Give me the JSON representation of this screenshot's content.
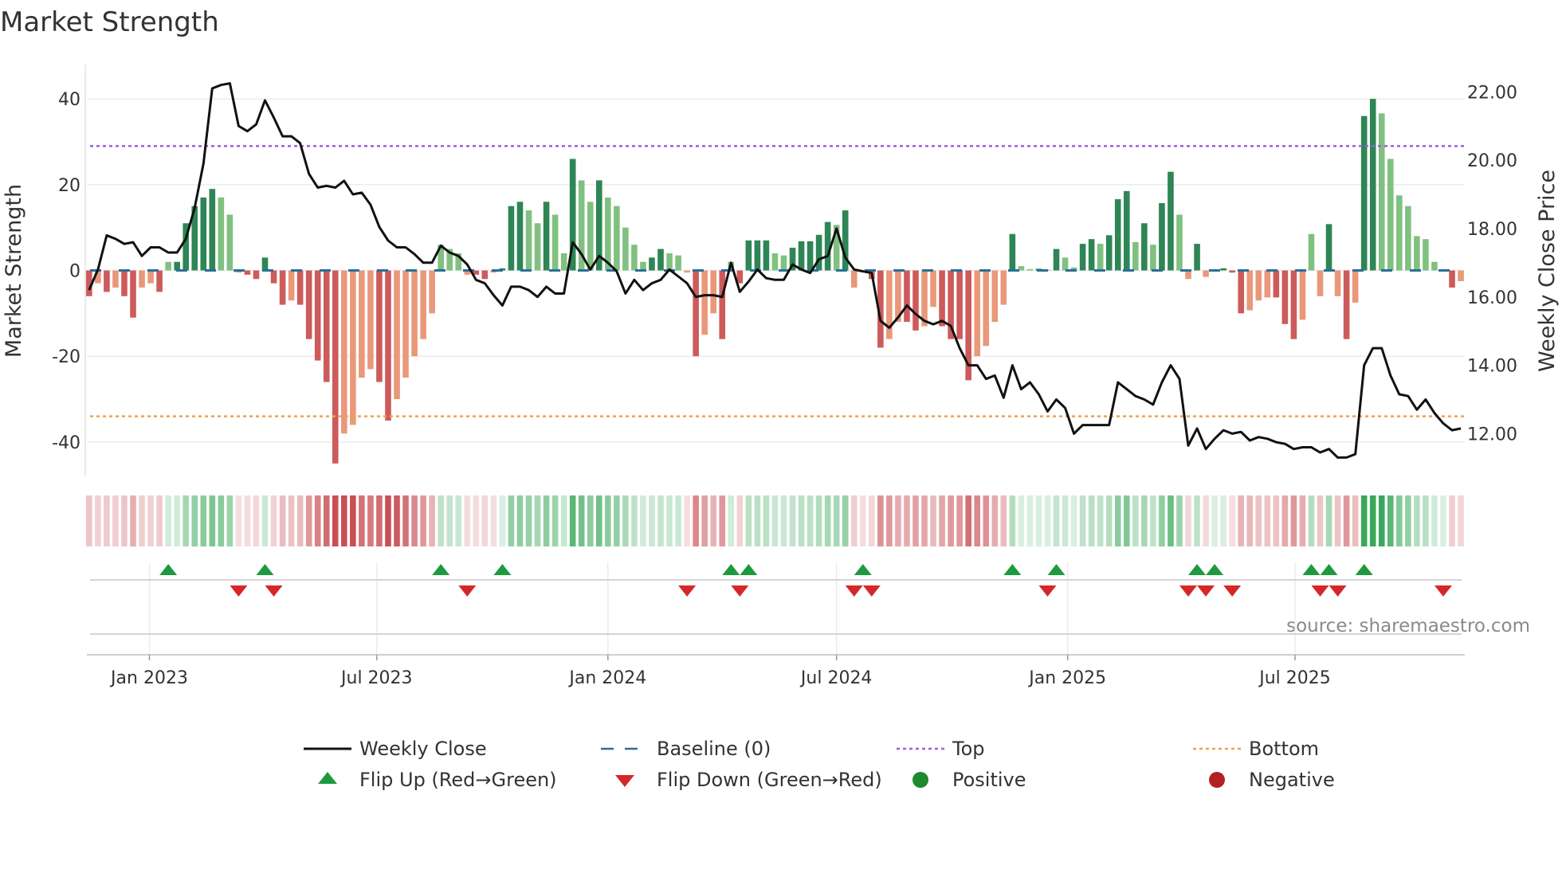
{
  "chart_data": {
    "type": "bar",
    "title": "Market Strength",
    "ylabel": "Market Strength",
    "ylabel_right": "Weekly Close Price",
    "ylim": [
      -48,
      48
    ],
    "ylim_right": [
      10.75,
      22.8
    ],
    "yticks": [
      -40,
      -20,
      0,
      20,
      40
    ],
    "yticks_right": [
      "12.00",
      "14.00",
      "16.00",
      "18.00",
      "20.00",
      "22.00"
    ],
    "xticks": [
      {
        "date": "2023-01-01",
        "label": "Jan 2023"
      },
      {
        "date": "2023-07-01",
        "label": "Jul 2023"
      },
      {
        "date": "2024-01-01",
        "label": "Jan 2024"
      },
      {
        "date": "2024-07-01",
        "label": "Jul 2024"
      },
      {
        "date": "2025-01-01",
        "label": "Jan 2025"
      },
      {
        "date": "2025-07-01",
        "label": "Jul 2025"
      }
    ],
    "start_date": "2022-11-14",
    "interval_days": 7,
    "top_level": 29,
    "bottom_level": -34,
    "baseline": 0,
    "strength": [
      -6,
      -3,
      -5,
      -4,
      -6,
      -11,
      -4,
      -3,
      -5,
      2,
      2,
      11,
      15,
      17,
      19,
      17,
      13,
      -0.5,
      -1,
      -2,
      3,
      -3,
      -8,
      -7,
      -8,
      -16,
      -21,
      -26,
      -45,
      -38,
      -36,
      -25,
      -23,
      -26,
      -35,
      -30,
      -25,
      -20,
      -16,
      -10,
      6,
      5,
      4,
      -1,
      -1,
      -2,
      -0.5,
      0.5,
      15,
      16,
      14,
      11,
      16,
      13,
      4,
      26,
      21,
      16,
      21,
      17,
      15,
      10,
      6,
      2,
      3,
      5,
      4,
      3.5,
      -0.5,
      -20,
      -15,
      -10,
      -16,
      2,
      -3,
      7,
      7,
      7,
      4,
      3.5,
      5.3,
      6.8,
      6.8,
      8.3,
      11.3,
      10.6,
      14,
      -4,
      -0.3,
      -2,
      -18,
      -16,
      -12,
      -12,
      -14,
      -13,
      -8.5,
      -13,
      -16,
      -16,
      -25.6,
      -20,
      -17.6,
      -12,
      -8,
      8.5,
      1,
      0.3,
      0.4,
      0.2,
      5,
      3,
      0.7,
      6.2,
      7.3,
      6.2,
      8.2,
      16.6,
      18.5,
      6.6,
      11,
      6,
      15.7,
      23,
      13,
      -2,
      6.2,
      -1.5,
      0,
      0.5,
      -0.5,
      -10,
      -9.3,
      -7,
      -6.3,
      -6.3,
      -12.5,
      -16,
      -11.5,
      8.5,
      -6,
      10.8,
      -6,
      -16,
      -7.5,
      36,
      40,
      36.6,
      26,
      17.5,
      15,
      8,
      7.3,
      2,
      0.2,
      -4,
      -2.5
    ],
    "close": [
      16.2,
      16.8,
      17.8,
      17.7,
      17.55,
      17.6,
      17.2,
      17.45,
      17.45,
      17.3,
      17.3,
      17.7,
      18.6,
      19.9,
      22.1,
      22.2,
      22.25,
      21.0,
      20.85,
      21.05,
      21.75,
      21.25,
      20.7,
      20.7,
      20.5,
      19.6,
      19.2,
      19.25,
      19.2,
      19.4,
      19.0,
      19.05,
      18.7,
      18.05,
      17.65,
      17.45,
      17.45,
      17.25,
      17.0,
      17.0,
      17.5,
      17.3,
      17.2,
      16.95,
      16.5,
      16.4,
      16.05,
      15.75,
      16.3,
      16.3,
      16.2,
      16.0,
      16.3,
      16.1,
      16.1,
      17.6,
      17.25,
      16.8,
      17.2,
      17.0,
      16.75,
      16.1,
      16.5,
      16.2,
      16.4,
      16.5,
      16.8,
      16.6,
      16.4,
      16.0,
      16.05,
      16.05,
      16.0,
      17.0,
      16.15,
      16.45,
      16.8,
      16.55,
      16.5,
      16.5,
      16.95,
      16.8,
      16.7,
      17.1,
      17.2,
      18.0,
      17.15,
      16.8,
      16.75,
      16.7,
      15.3,
      15.1,
      15.4,
      15.75,
      15.5,
      15.3,
      15.2,
      15.3,
      15.15,
      14.5,
      14.0,
      14.0,
      13.6,
      13.7,
      13.05,
      14.0,
      13.3,
      13.5,
      13.15,
      12.65,
      13.0,
      12.75,
      12.0,
      12.25,
      12.25,
      12.25,
      12.25,
      13.5,
      13.3,
      13.1,
      13.0,
      12.85,
      13.5,
      14.0,
      13.6,
      11.65,
      12.15,
      11.55,
      11.85,
      12.1,
      12.0,
      12.05,
      11.8,
      11.9,
      11.85,
      11.75,
      11.7,
      11.55,
      11.6,
      11.6,
      11.45,
      11.55,
      11.3,
      11.3,
      11.4,
      14.0,
      14.5,
      14.5,
      13.7,
      13.15,
      13.1,
      12.7,
      13.0,
      12.6,
      12.3,
      12.1,
      12.15
    ],
    "flip_up_weeks": [
      9,
      20,
      40,
      47,
      73,
      75,
      88,
      105,
      110,
      126,
      128,
      139,
      141,
      145
    ],
    "flip_down_weeks": [
      17,
      21,
      43,
      68,
      74,
      87,
      89,
      109,
      125,
      127,
      130,
      140,
      142,
      154
    ],
    "legend": [
      {
        "label": "Weekly Close",
        "kind": "line"
      },
      {
        "label": "Baseline (0)",
        "kind": "dash"
      },
      {
        "label": "Top",
        "kind": "dot-purple"
      },
      {
        "label": "Bottom",
        "kind": "dot-orange"
      },
      {
        "label": "Flip Up (Red→Green)",
        "kind": "tri-up"
      },
      {
        "label": "Flip Down (Green→Red)",
        "kind": "tri-down"
      },
      {
        "label": "Positive",
        "kind": "dot-green"
      },
      {
        "label": "Negative",
        "kind": "dot-red"
      }
    ],
    "legend_placement": "bottom",
    "source": "source: sharemaestro.com"
  },
  "colors": {
    "pos_strong": "#2e8555",
    "pos_weak": "#80c080",
    "neg_strong": "#cd5b5b",
    "neg_weak": "#e9987a",
    "line": "#111111",
    "baseline": "#2a6f97",
    "top": "#9b5fe0",
    "bottom": "#f0a050",
    "flip_up": "#1e9a3e",
    "flip_down": "#d62728",
    "positive": "#1e8a2e",
    "negative": "#b22222"
  }
}
